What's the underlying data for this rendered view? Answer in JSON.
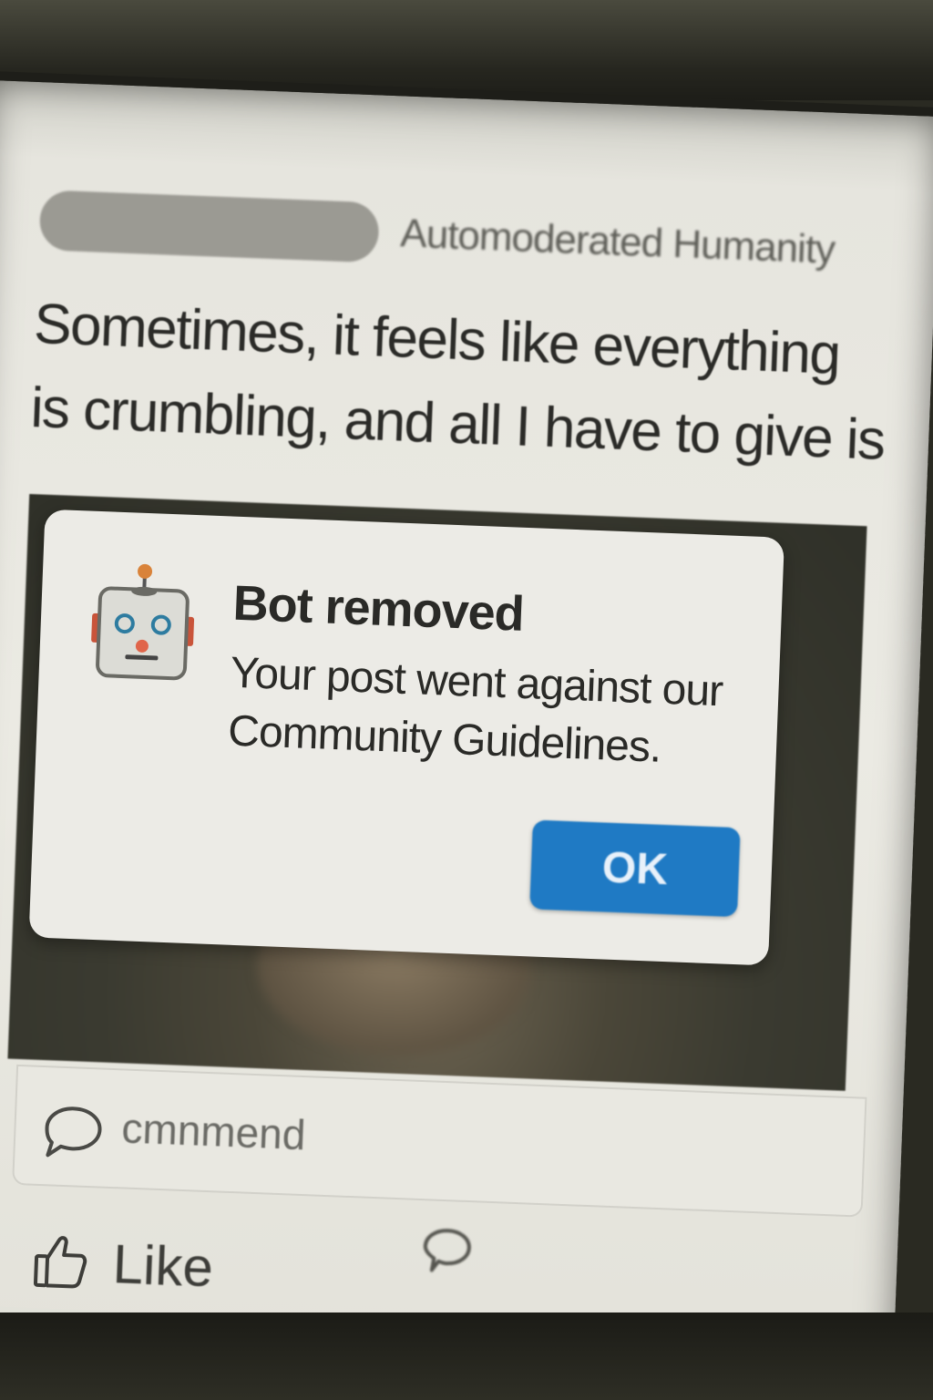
{
  "post": {
    "group_name": "Automoderated Humanity",
    "text": "Sometimes, it feels like everything is crumbling, and all I have to give is"
  },
  "dialog": {
    "icon": "robot-icon",
    "title": "Bot removed",
    "message": "Your post went against our Community Guidelines.",
    "ok_label": "OK"
  },
  "comment": {
    "icon": "speech-bubble-icon",
    "placeholder": "cmnmend"
  },
  "actions": {
    "like_label": "Like",
    "like_icon": "thumbs-up-icon",
    "comment_icon": "speech-bubble-icon"
  },
  "colors": {
    "ok_button": "#1f7ac4",
    "dialog_background": "#ecebe6"
  }
}
